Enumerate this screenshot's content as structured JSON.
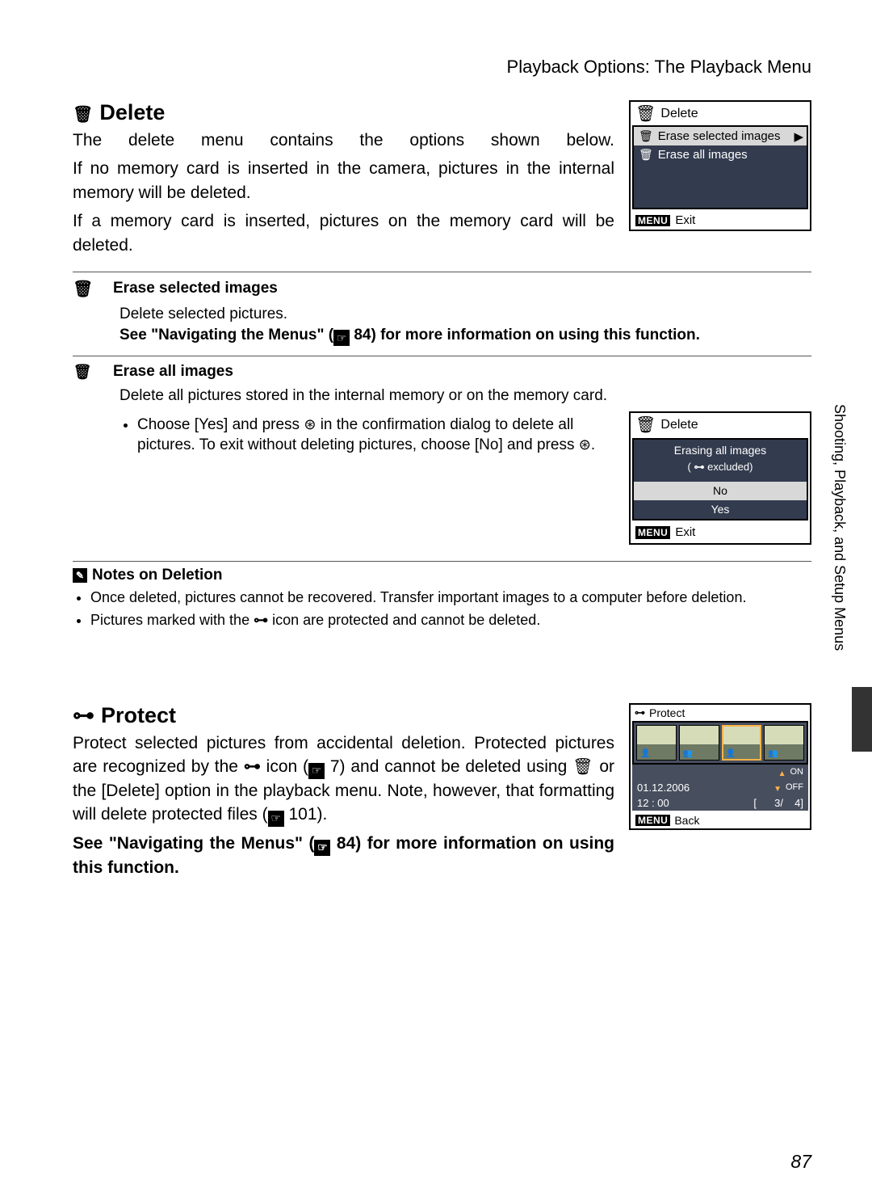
{
  "header": {
    "breadcrumb": "Playback Options: The Playback Menu"
  },
  "side_tab": "Shooting, Playback, and Setup Menus",
  "page_number": "87",
  "delete": {
    "title": "Delete",
    "p1": "The delete menu contains the options shown below.",
    "p2": "If no memory card is inserted in the camera, pictures in the internal memory will be deleted.",
    "p3": "If a memory card is inserted, pictures on the memory card will be deleted.",
    "screen": {
      "title": "Delete",
      "item1": "Erase selected images",
      "item2": "Erase all images",
      "exit": "Exit",
      "menu_label": "MENU"
    },
    "opt1": {
      "title": "Erase selected images",
      "body": "Delete selected pictures.",
      "see_a": "See \"Navigating the Menus\" (",
      "see_ref": "84",
      "see_b": ") for more information on using this function."
    },
    "opt2": {
      "title": "Erase all images",
      "body": "Delete all pictures stored in the internal memory or on the memory card.",
      "bullet_a": "Choose [Yes] and press ",
      "bullet_b": " in the confirmation dialog to delete all pictures. To exit without deleting pictures, choose [No] and press ",
      "bullet_c": ".",
      "screen": {
        "title": "Delete",
        "msg": "Erasing all images",
        "sub_a": "( ",
        "sub_b": " excluded)",
        "no": "No",
        "yes": "Yes",
        "exit": "Exit",
        "menu_label": "MENU"
      }
    },
    "notes": {
      "title": "Notes on Deletion",
      "b1": "Once deleted, pictures cannot be recovered. Transfer important images to a computer before deletion.",
      "b2a": "Pictures marked with the ",
      "b2b": " icon are protected and cannot be deleted."
    }
  },
  "protect": {
    "title": "Protect",
    "p_a": "Protect selected pictures from accidental deletion. Protected pictures are recognized by the ",
    "p_b": " icon (",
    "ref1": "7",
    "p_c": ") and cannot be deleted using ",
    "p_d": " or the [Delete] option in the playback menu. Note, however, that formatting will delete protected files (",
    "ref2": "101",
    "p_e": ").",
    "see_a": "See \"Navigating the Menus\" (",
    "see_ref": "84",
    "see_b": ") for more information on using this function.",
    "screen": {
      "title": "Protect",
      "on": "ON",
      "off": "OFF",
      "date": "01.12.2006",
      "time": "12 : 00",
      "counter_a": "[",
      "idx": "3/",
      "total": "4]",
      "back": "Back",
      "menu_label": "MENU"
    }
  }
}
